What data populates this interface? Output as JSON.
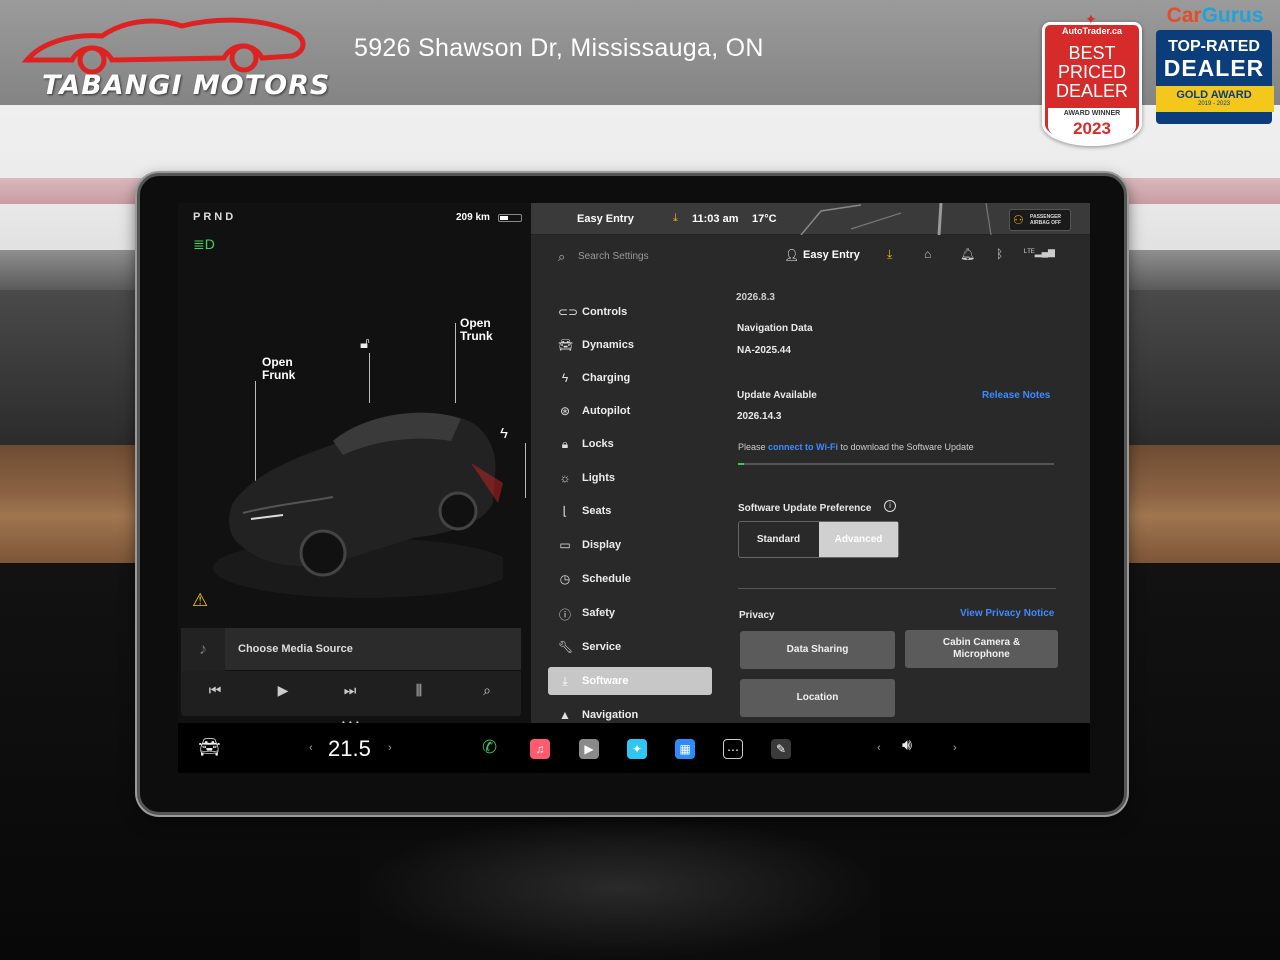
{
  "dealer": {
    "name": "TABANGI MOTORS",
    "address": "5926 Shawson Dr, Mississauga, ON"
  },
  "badges": {
    "autotrader": {
      "brand": "AutoTrader.ca",
      "line1": "BEST",
      "line2": "PRICED",
      "line3": "DEALER",
      "award": "AWARD WINNER",
      "year": "2023",
      "color": "#d52b2b"
    },
    "cargurus": {
      "brand_a": "Car",
      "brand_b": "Gurus",
      "line1": "TOP-RATED",
      "line2": "DEALER",
      "award": "GOLD AWARD",
      "years": "2019 - 2023",
      "color": "#0b3d7a",
      "gold": "#f3c71c"
    }
  },
  "car_panel": {
    "gear": "PRND",
    "range": "209 km",
    "headlight_icon": "headlight-icon",
    "frunk_label": "Open\nFrunk",
    "trunk_label": "Open\nTrunk",
    "lock_icon": "unlock-icon",
    "charge_icon": "lightning-icon",
    "warning_icon": "warning-triangle-icon"
  },
  "media": {
    "source": "Choose Media Source",
    "controls": [
      "previous-icon",
      "play-icon",
      "next-icon",
      "equalizer-icon",
      "search-icon"
    ]
  },
  "status_bar": {
    "profile": "Easy Entry",
    "time": "11:03 am",
    "temperature": "17°C",
    "airbag_label": "PASSENGER\nAIRBAG OFF"
  },
  "settings_top": {
    "search_placeholder": "Search Settings",
    "profile": "Easy Entry",
    "icons": [
      "download-icon",
      "home-icon",
      "bell-icon",
      "bluetooth-icon",
      "lte-signal-icon"
    ]
  },
  "nav": [
    {
      "label": "Controls",
      "icon": "toggle-icon"
    },
    {
      "label": "Dynamics",
      "icon": "car-icon"
    },
    {
      "label": "Charging",
      "icon": "lightning-icon"
    },
    {
      "label": "Autopilot",
      "icon": "steering-wheel-icon"
    },
    {
      "label": "Locks",
      "icon": "lock-icon"
    },
    {
      "label": "Lights",
      "icon": "sun-icon"
    },
    {
      "label": "Seats",
      "icon": "seat-icon"
    },
    {
      "label": "Display",
      "icon": "display-icon"
    },
    {
      "label": "Schedule",
      "icon": "clock-icon"
    },
    {
      "label": "Safety",
      "icon": "safety-icon"
    },
    {
      "label": "Service",
      "icon": "wrench-icon"
    },
    {
      "label": "Software",
      "icon": "download-icon",
      "active": true
    },
    {
      "label": "Navigation",
      "icon": "navigation-icon"
    }
  ],
  "software": {
    "current_version": "2026.8.3",
    "nav_data_label": "Navigation Data",
    "nav_data_value": "NA-2025.44",
    "update_label": "Update Available",
    "update_version": "2026.14.3",
    "release_notes": "Release Notes",
    "notice_pre": "Please",
    "notice_link": "connect to Wi-Fi",
    "notice_post": "to download the Software Update",
    "download_progress": 0.01,
    "preference_label": "Software Update Preference",
    "preference_options": [
      "Standard",
      "Advanced"
    ],
    "preference_selected": "Advanced"
  },
  "privacy": {
    "label": "Privacy",
    "notice_link": "View Privacy Notice",
    "buttons": [
      "Data Sharing",
      "Cabin Camera &\nMicrophone",
      "Location"
    ]
  },
  "dock": {
    "car_icon": "car-icon",
    "temperature": "21.5",
    "apps": [
      "phone-icon",
      "music-icon",
      "media-player-icon",
      "toybox-icon",
      "calendar-icon",
      "more-apps-icon",
      "dashcam-icon"
    ],
    "volume_icon": "volume-icon",
    "colors": {
      "phone": "#34c759",
      "music": "#ff5a6e",
      "toybox": "#2fc7f2",
      "calendar": "#2a8cff"
    }
  }
}
